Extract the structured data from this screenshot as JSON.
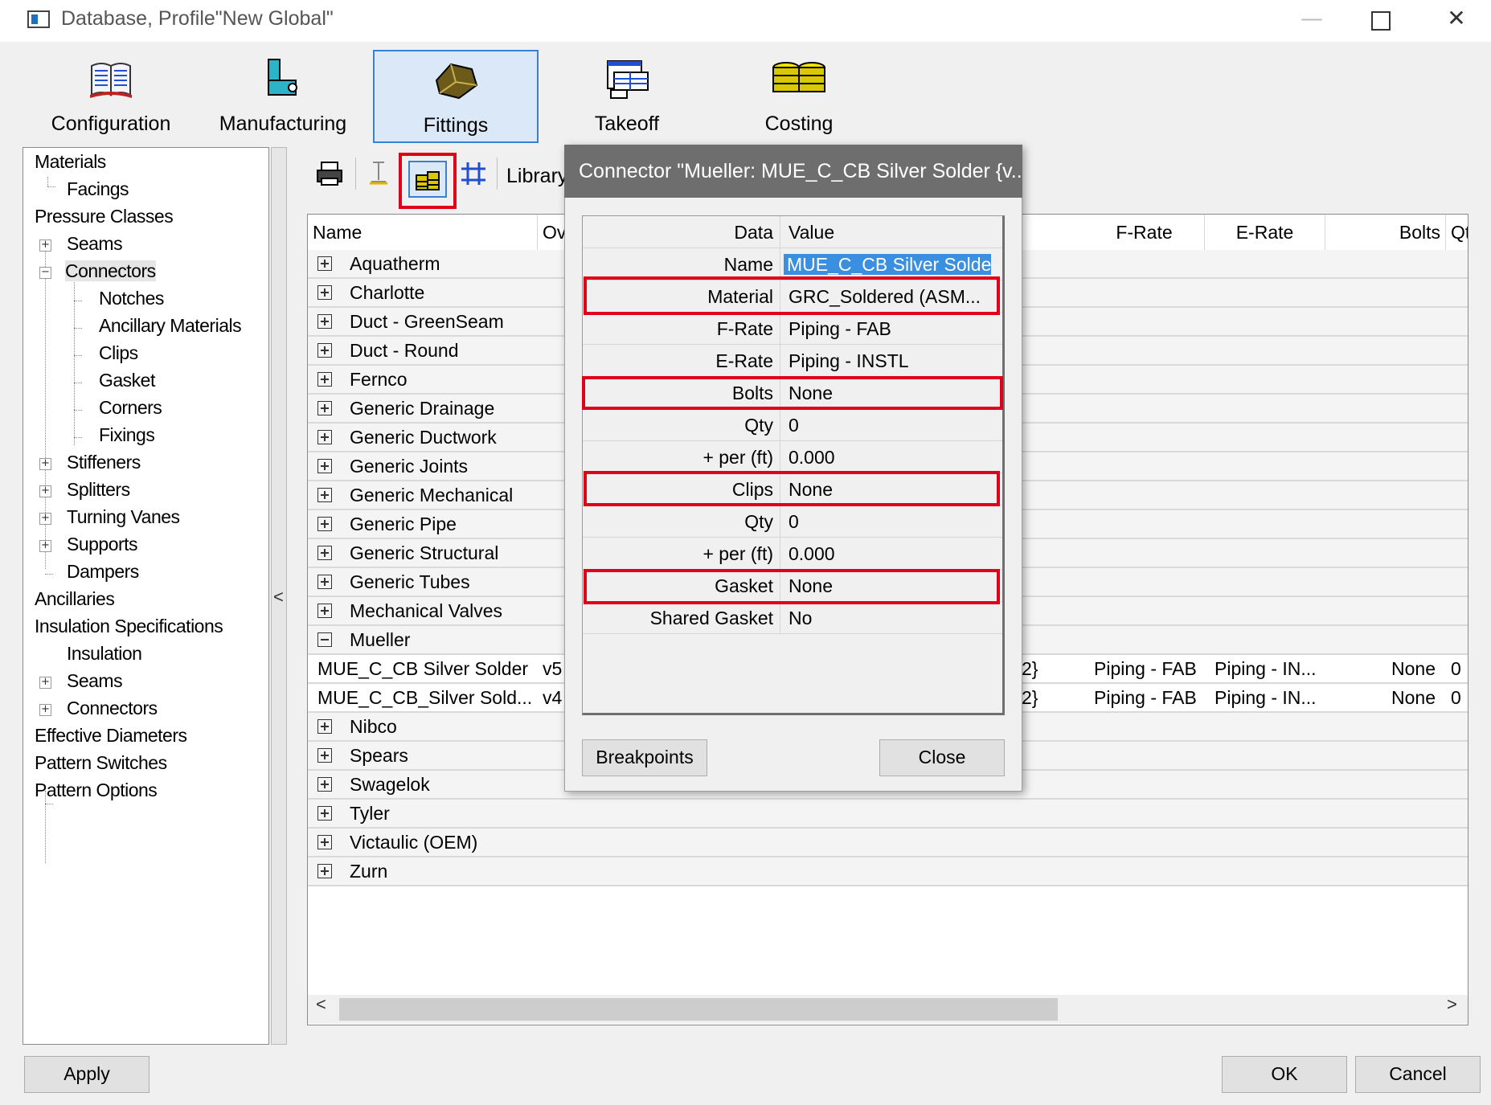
{
  "window": {
    "title": "Database, Profile\"New Global\""
  },
  "categories": [
    {
      "label": "Configuration",
      "icon": "book-icon"
    },
    {
      "label": "Manufacturing",
      "icon": "machine-icon"
    },
    {
      "label": "Fittings",
      "icon": "fitting-icon",
      "active": true
    },
    {
      "label": "Takeoff",
      "icon": "takeoff-icon"
    },
    {
      "label": "Costing",
      "icon": "coins-icon"
    }
  ],
  "tree": {
    "items": [
      "Materials",
      "Facings",
      "Pressure Classes",
      "Seams",
      "Connectors",
      "Notches",
      "Ancillary Materials",
      "Clips",
      "Gasket",
      "Corners",
      "Fixings",
      "Stiffeners",
      "Splitters",
      "Turning Vanes",
      "Supports",
      "Dampers",
      "Ancillaries",
      "Insulation Specifications",
      "Insulation",
      "Seams",
      "Connectors",
      "Effective Diameters",
      "Pattern Switches",
      "Pattern Options"
    ]
  },
  "toolbar": {
    "library_label": "Library"
  },
  "grid": {
    "headers": {
      "name": "Name",
      "ow": "Ov",
      "frate": "F-Rate",
      "erate": "E-Rate",
      "bolts": "Bolts",
      "qt": "Qt"
    },
    "groups": [
      "Aquatherm",
      "Charlotte",
      "Duct - GreenSeam",
      "Duct - Round",
      "Fernco",
      "Generic Drainage",
      "Generic Ductwork",
      "Generic Joints",
      "Generic Mechanical",
      "Generic Pipe",
      "Generic Structural",
      "Generic Tubes",
      "Mechanical Valves",
      "Mueller"
    ],
    "mueller_rows": [
      {
        "name": "MUE_C_CB Silver Solder",
        "ow": "v5",
        "mid": "2}",
        "frate": "Piping - FAB",
        "erate": "Piping - IN...",
        "bolts": "None",
        "qt": "0"
      },
      {
        "name": "MUE_C_CB_Silver Sold...",
        "ow": "v4",
        "mid": "2}",
        "frate": "Piping - FAB",
        "erate": "Piping - IN...",
        "bolts": "None",
        "qt": "0"
      }
    ],
    "groups_after": [
      "Nibco",
      "Spears",
      "Swagelok",
      "Tyler",
      "Victaulic (OEM)",
      "Zurn"
    ]
  },
  "dialog": {
    "title": "Connector \"Mueller: MUE_C_CB Silver Solder {v...",
    "col_data": "Data",
    "col_value": "Value",
    "rows": [
      {
        "label": "Name",
        "value": "MUE_C_CB Silver Solder"
      },
      {
        "label": "Material",
        "value": "GRC_Soldered (ASM..."
      },
      {
        "label": "F-Rate",
        "value": "Piping - FAB"
      },
      {
        "label": "E-Rate",
        "value": "Piping - INSTL"
      },
      {
        "label": "Bolts",
        "value": "None"
      },
      {
        "label": "Qty",
        "value": "0"
      },
      {
        "label": "+ per (ft)",
        "value": "0.000"
      },
      {
        "label": "Clips",
        "value": "None"
      },
      {
        "label": "Qty",
        "value": "0"
      },
      {
        "label": "+ per (ft)",
        "value": "0.000"
      },
      {
        "label": "Gasket",
        "value": "None"
      },
      {
        "label": "Shared Gasket",
        "value": "No"
      }
    ],
    "breakpoints_label": "Breakpoints",
    "close_label": "Close"
  },
  "footer": {
    "apply_label": "Apply",
    "ok_label": "OK",
    "cancel_label": "Cancel"
  },
  "colors": {
    "highlight": "#e0001a",
    "selection": "#3b8fe0",
    "active_tab": "#dbe8f7"
  }
}
